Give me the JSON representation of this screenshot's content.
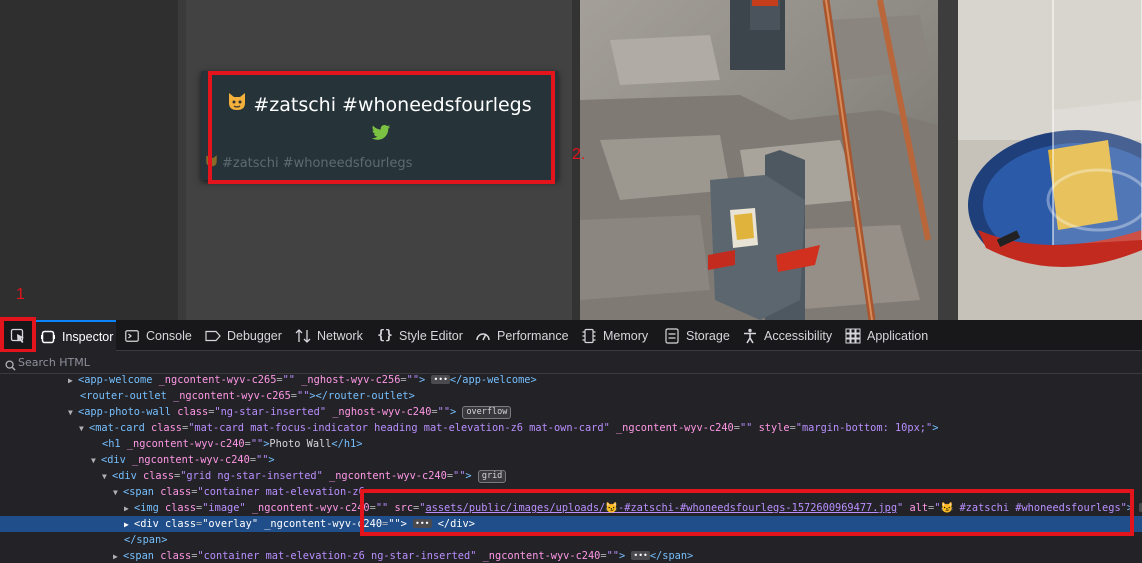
{
  "overlay": {
    "title": "#zatschi #whoneedsfourlegs",
    "caption": "#zatschi #whoneedsfourlegs"
  },
  "annotations": {
    "label1": "1",
    "label2": "2."
  },
  "devtools": {
    "tabs": [
      {
        "label": "Inspector",
        "icon": "inspector-icon"
      },
      {
        "label": "Console",
        "icon": "console-icon"
      },
      {
        "label": "Debugger",
        "icon": "debugger-icon"
      },
      {
        "label": "Network",
        "icon": "network-icon"
      },
      {
        "label": "Style Editor",
        "icon": "style-editor-icon"
      },
      {
        "label": "Performance",
        "icon": "performance-icon"
      },
      {
        "label": "Memory",
        "icon": "memory-icon"
      },
      {
        "label": "Storage",
        "icon": "storage-icon"
      },
      {
        "label": "Accessibility",
        "icon": "accessibility-icon"
      },
      {
        "label": "Application",
        "icon": "application-icon"
      }
    ],
    "search_placeholder": "Search HTML"
  },
  "dom": {
    "r0": {
      "open": "<app-welcome",
      "a1": "_ngcontent-wyv-c265",
      "a2": "_nghost-wyv-c256",
      "close": "</app-welcome>"
    },
    "r1": {
      "open": "<router-outlet",
      "a1": "_ngcontent-wyv-c265",
      "close": "</router-outlet>"
    },
    "r2": {
      "open": "<app-photo-wall",
      "a1": "class",
      "v1": "ng-star-inserted",
      "a2": "_nghost-wyv-c240",
      "badge": "overflow"
    },
    "r3": {
      "open": "<mat-card",
      "a1": "class",
      "v1": "mat-card mat-focus-indicator heading mat-elevation-z6 mat-own-card",
      "a2": "_ngcontent-wyv-c240",
      "a3": "style",
      "v3": "margin-bottom: 10px;"
    },
    "r4": {
      "open": "<h1",
      "a1": "_ngcontent-wyv-c240",
      "text": "Photo Wall",
      "close": "</h1>"
    },
    "r5": {
      "open": "<div",
      "a1": "_ngcontent-wyv-c240"
    },
    "r6": {
      "open": "<div",
      "a1": "class",
      "v1": "grid ng-star-inserted",
      "a2": "_ngcontent-wyv-c240",
      "badge": "grid"
    },
    "r7": {
      "open": "<span",
      "a1": "class",
      "v1": "container mat-elevation-z6"
    },
    "r8": {
      "open": "<img",
      "a1": "class",
      "v1": "image",
      "a2": "_ngcontent-wyv-c240",
      "a3": "src",
      "v3": "assets/public/images/uploads/😼-#zatschi-#whoneedsfourlegs-1572600969477.jpg",
      "a4": "alt",
      "v4": "😼 #zatschi #whoneedsfourlegs"
    },
    "r9": {
      "open": "<div",
      "a1": "class",
      "v1": "overlay",
      "a2": "_ngcontent-wyv-c240",
      "close": "</div>"
    },
    "r10": {
      "close": "</span>"
    },
    "r11": {
      "open": "<span",
      "a1": "class",
      "v1": "container mat-elevation-z6 ng-star-inserted",
      "a2": "_ngcontent-wyv-c240",
      "close": "</span>"
    }
  },
  "colors": {
    "annotation_red": "#e3141c",
    "selected_row": "#204e8a",
    "accent_blue": "#0a84ff"
  }
}
